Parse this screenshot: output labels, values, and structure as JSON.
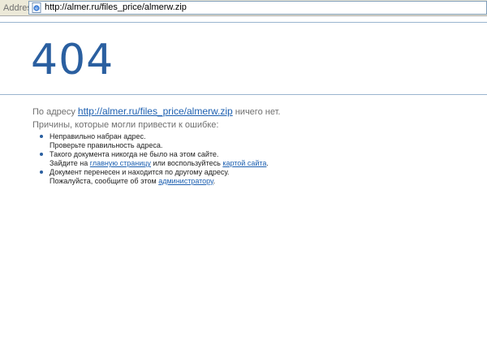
{
  "browser": {
    "address_label": "Address",
    "address_url": "http://almer.ru/files_price/almerw.zip"
  },
  "page": {
    "error_code": "404",
    "line1_prefix": "По адресу",
    "line1_link": "http://almer.ru/files_price/almerw.zip",
    "line1_suffix": "ничего нет.",
    "line2": "Причины, которые могли привести к ошибке:",
    "reasons": [
      {
        "line1": "Неправильно набран адрес.",
        "line2": "Проверьте правильность адреса."
      },
      {
        "line1": "Такого документа никогда не было на этом сайте.",
        "line2_prefix": "Зайдите на",
        "line2_link1": "главную страницу",
        "line2_middle": "или воспользуйтесь",
        "line2_link2": "картой сайта",
        "line2_suffix": "."
      },
      {
        "line1": "Документ перенесен и находится по другому адресу.",
        "line2_prefix": "Пожалуйста, сообщите об этом",
        "line2_link": "администратору",
        "line2_suffix": "."
      }
    ]
  },
  "colors": {
    "accent": "#2a5fa0",
    "link": "#1c5fb0",
    "muted_text": "#6f6f6f"
  },
  "icons": {
    "page_icon": "ie-page-icon",
    "bullet": "bullet-dot"
  }
}
